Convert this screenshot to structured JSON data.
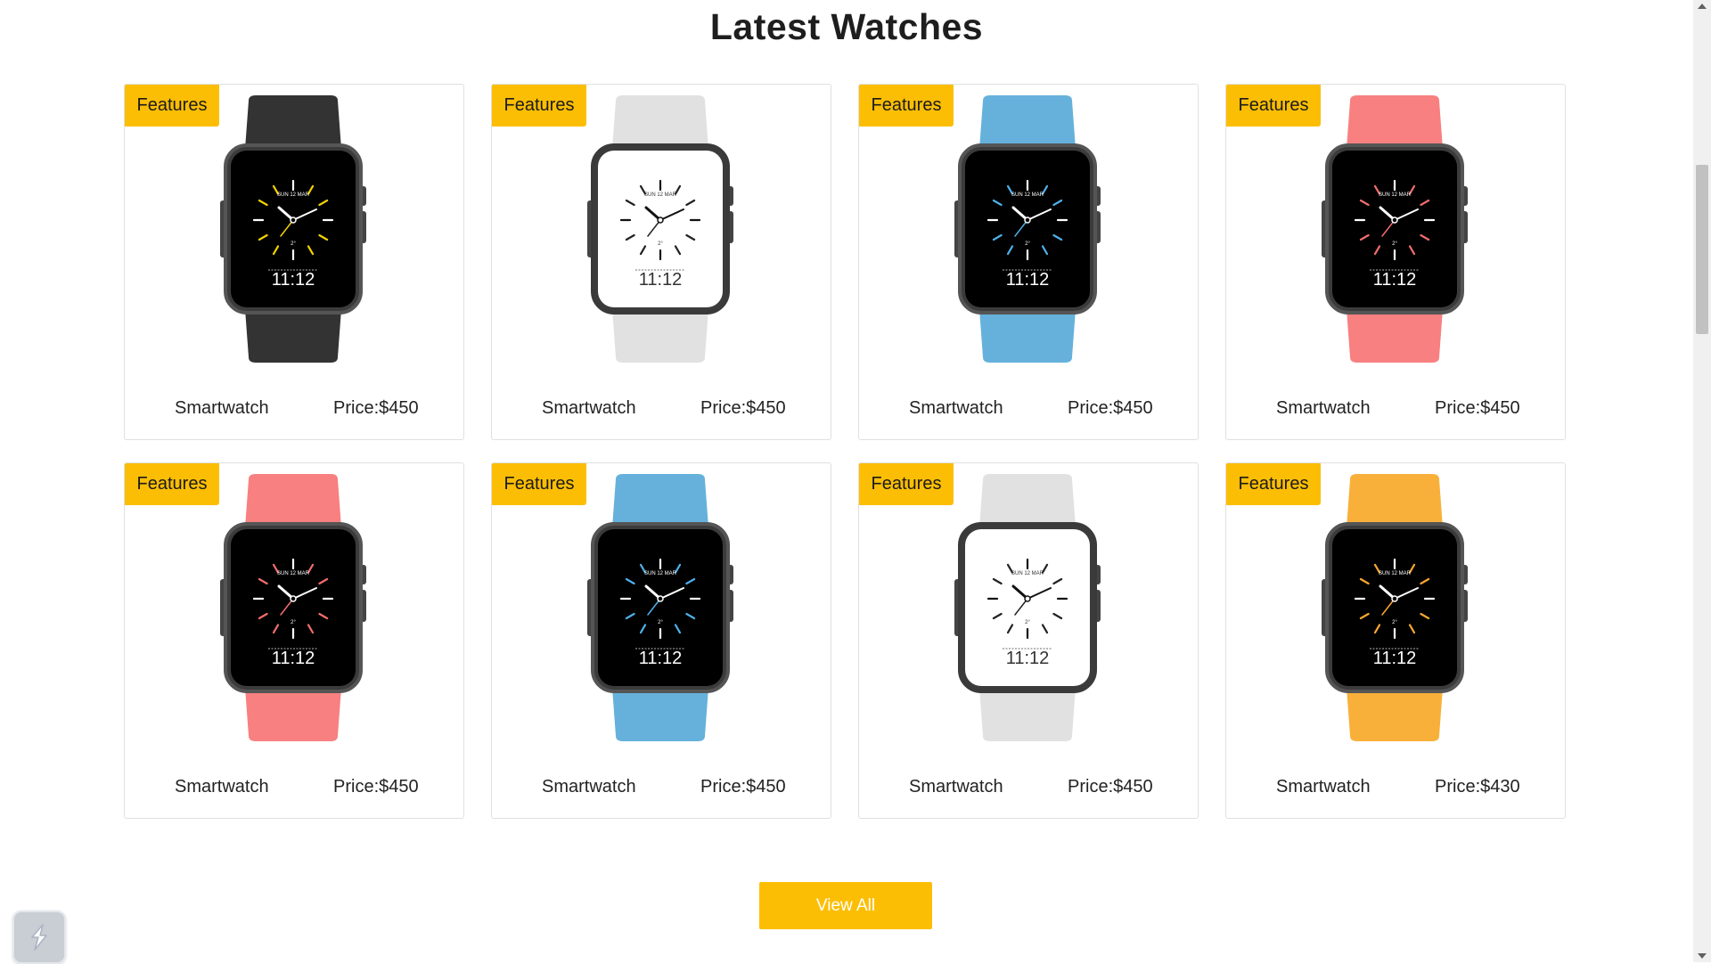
{
  "section": {
    "title": "Latest Watches"
  },
  "products": [
    {
      "badge": "Features",
      "name": "Smartwatch",
      "price": "Price:$450",
      "band_color": "#333333",
      "face": "dark",
      "accent": "#f2d200",
      "time": "11:12"
    },
    {
      "badge": "Features",
      "name": "Smartwatch",
      "price": "Price:$450",
      "band_color": "#e1e1e1",
      "face": "light",
      "accent": "#222222",
      "time": "11:12"
    },
    {
      "badge": "Features",
      "name": "Smartwatch",
      "price": "Price:$450",
      "band_color": "#65b1dc",
      "face": "dark",
      "accent": "#4fb0e8",
      "time": "11:12"
    },
    {
      "badge": "Features",
      "name": "Smartwatch",
      "price": "Price:$450",
      "band_color": "#f88080",
      "face": "dark",
      "accent": "#f26d6d",
      "time": "11:12"
    },
    {
      "badge": "Features",
      "name": "Smartwatch",
      "price": "Price:$450",
      "band_color": "#f88080",
      "face": "dark",
      "accent": "#f26d6d",
      "time": "11:12"
    },
    {
      "badge": "Features",
      "name": "Smartwatch",
      "price": "Price:$450",
      "band_color": "#65b1dc",
      "face": "dark",
      "accent": "#4fb0e8",
      "time": "11:12"
    },
    {
      "badge": "Features",
      "name": "Smartwatch",
      "price": "Price:$450",
      "band_color": "#e1e1e1",
      "face": "light",
      "accent": "#222222",
      "time": "11:12"
    },
    {
      "badge": "Features",
      "name": "Smartwatch",
      "price": "Price:$430",
      "band_color": "#f9b03a",
      "face": "dark",
      "accent": "#f9a72e",
      "time": "11:12"
    }
  ],
  "actions": {
    "view_all": "View All"
  },
  "colors": {
    "accent": "#fcbe04"
  }
}
